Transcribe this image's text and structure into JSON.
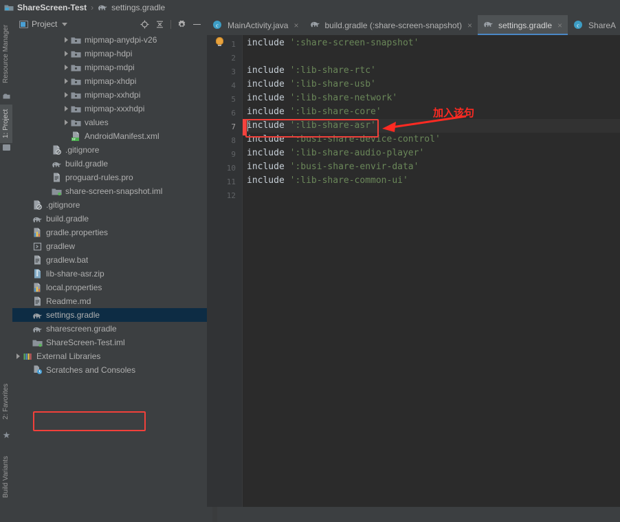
{
  "titlebar": {
    "project_icon": "folder-project-icon",
    "project_name": "ShareScreen-Test",
    "separator": "›",
    "file_icon": "gradle-elephant-icon",
    "file_name": "settings.gradle"
  },
  "left_strip": {
    "tabs": [
      {
        "label": "Resource Manager",
        "icon": "resource-manager-icon",
        "active": false
      },
      {
        "label": "1: Project",
        "icon": "project-folder-icon",
        "active": true
      },
      {
        "label": "2: Favorites",
        "icon": "star-icon",
        "active": false
      },
      {
        "label": "Build Variants",
        "icon": "build-variants-icon",
        "active": false
      }
    ]
  },
  "project_panel": {
    "title": "Project",
    "dropdown_icon": "chevron-down-icon",
    "toolbar_icons": [
      {
        "name": "locate-target-icon"
      },
      {
        "name": "collapse-all-icon"
      },
      {
        "name": "gear-icon"
      },
      {
        "name": "hide-minimize-icon"
      }
    ],
    "tree": [
      {
        "label": "mipmap-anydpi-v26",
        "indent": 5,
        "arrow": true,
        "icon": "folder-res-icon",
        "selected": false
      },
      {
        "label": "mipmap-hdpi",
        "indent": 5,
        "arrow": true,
        "icon": "folder-res-icon",
        "selected": false
      },
      {
        "label": "mipmap-mdpi",
        "indent": 5,
        "arrow": true,
        "icon": "folder-res-icon",
        "selected": false
      },
      {
        "label": "mipmap-xhdpi",
        "indent": 5,
        "arrow": true,
        "icon": "folder-res-icon",
        "selected": false
      },
      {
        "label": "mipmap-xxhdpi",
        "indent": 5,
        "arrow": true,
        "icon": "folder-res-icon",
        "selected": false
      },
      {
        "label": "mipmap-xxxhdpi",
        "indent": 5,
        "arrow": true,
        "icon": "folder-res-icon",
        "selected": false
      },
      {
        "label": "values",
        "indent": 5,
        "arrow": true,
        "icon": "folder-res-icon",
        "selected": false
      },
      {
        "label": "AndroidManifest.xml",
        "indent": 5,
        "arrow": false,
        "icon": "manifest-xml-icon",
        "selected": false
      },
      {
        "label": ".gitignore",
        "indent": 3,
        "arrow": false,
        "icon": "gitignore-icon",
        "selected": false
      },
      {
        "label": "build.gradle",
        "indent": 3,
        "arrow": false,
        "icon": "gradle-elephant-icon",
        "selected": false
      },
      {
        "label": "proguard-rules.pro",
        "indent": 3,
        "arrow": false,
        "icon": "text-file-icon",
        "selected": false
      },
      {
        "label": "share-screen-snapshot.iml",
        "indent": 3,
        "arrow": false,
        "icon": "iml-module-icon",
        "selected": false
      },
      {
        "label": ".gitignore",
        "indent": 1,
        "arrow": false,
        "icon": "gitignore-icon",
        "selected": false
      },
      {
        "label": "build.gradle",
        "indent": 1,
        "arrow": false,
        "icon": "gradle-elephant-icon",
        "selected": false
      },
      {
        "label": "gradle.properties",
        "indent": 1,
        "arrow": false,
        "icon": "properties-icon",
        "selected": false
      },
      {
        "label": "gradlew",
        "indent": 1,
        "arrow": false,
        "icon": "shell-script-icon",
        "selected": false
      },
      {
        "label": "gradlew.bat",
        "indent": 1,
        "arrow": false,
        "icon": "text-file-icon",
        "selected": false
      },
      {
        "label": "lib-share-asr.zip",
        "indent": 1,
        "arrow": false,
        "icon": "zip-archive-icon",
        "selected": false
      },
      {
        "label": "local.properties",
        "indent": 1,
        "arrow": false,
        "icon": "properties-icon",
        "selected": false
      },
      {
        "label": "Readme.md",
        "indent": 1,
        "arrow": false,
        "icon": "text-file-icon",
        "selected": false
      },
      {
        "label": "settings.gradle",
        "indent": 1,
        "arrow": false,
        "icon": "gradle-elephant-icon",
        "selected": true
      },
      {
        "label": "sharescreen.gradle",
        "indent": 1,
        "arrow": false,
        "icon": "gradle-elephant-icon",
        "selected": false
      },
      {
        "label": "ShareScreen-Test.iml",
        "indent": 1,
        "arrow": false,
        "icon": "iml-module-icon",
        "selected": false
      },
      {
        "label": "External Libraries",
        "indent": 0,
        "arrow": true,
        "icon": "external-libraries-icon",
        "selected": false
      },
      {
        "label": "Scratches and Consoles",
        "indent": 1,
        "arrow": false,
        "icon": "scratches-icon",
        "selected": false
      }
    ]
  },
  "editor_tabs": [
    {
      "label": "MainActivity.java",
      "icon": "java-class-icon",
      "active": false,
      "closable": true
    },
    {
      "label": "build.gradle (:share-screen-snapshot)",
      "icon": "gradle-elephant-icon",
      "active": false,
      "closable": true
    },
    {
      "label": "settings.gradle",
      "icon": "gradle-elephant-icon",
      "active": true,
      "closable": true
    },
    {
      "label": "ShareA",
      "icon": "java-class-icon",
      "active": false,
      "closable": false
    }
  ],
  "editor": {
    "close_glyph": "×",
    "line_numbers": [
      "1",
      "2",
      "3",
      "4",
      "5",
      "6",
      "7",
      "8",
      "9",
      "10",
      "11",
      "12"
    ],
    "current_line": 7,
    "lines": [
      {
        "n": 1,
        "keyword": "include",
        "string": "':share-screen-snapshot'"
      },
      {
        "n": 2,
        "keyword": "",
        "string": ""
      },
      {
        "n": 3,
        "keyword": "include",
        "string": "':lib-share-rtc'"
      },
      {
        "n": 4,
        "keyword": "include",
        "string": "':lib-share-usb'"
      },
      {
        "n": 5,
        "keyword": "include",
        "string": "':lib-share-network'"
      },
      {
        "n": 6,
        "keyword": "include",
        "string": "':lib-share-core'"
      },
      {
        "n": 7,
        "keyword": "include",
        "string": "':lib-share-asr'"
      },
      {
        "n": 8,
        "keyword": "include",
        "string": "':busi-share-device-control'"
      },
      {
        "n": 9,
        "keyword": "include",
        "string": "':lib-share-audio-player'"
      },
      {
        "n": 10,
        "keyword": "include",
        "string": "':busi-share-envir-data'"
      },
      {
        "n": 11,
        "keyword": "include",
        "string": "':lib-share-common-ui'"
      },
      {
        "n": 12,
        "keyword": "",
        "string": ""
      }
    ],
    "intention_bulb": "lightbulb-icon",
    "error_stripe_color": "#f5433f"
  },
  "annotations": {
    "callout_text": "加入该句",
    "color": "#ff2a22",
    "arrow_icon": "left-arrow-annotation",
    "code_highlight_box": "highlight-box-code-line-7",
    "tree_highlight_box": "highlight-box-settings-gradle"
  },
  "colors": {
    "accent": "#4a88c7",
    "annotation_red": "#ff2a22",
    "string_green": "#6a8759",
    "keyword": "#c7d0d8",
    "selected_row": "#0d2c44"
  }
}
